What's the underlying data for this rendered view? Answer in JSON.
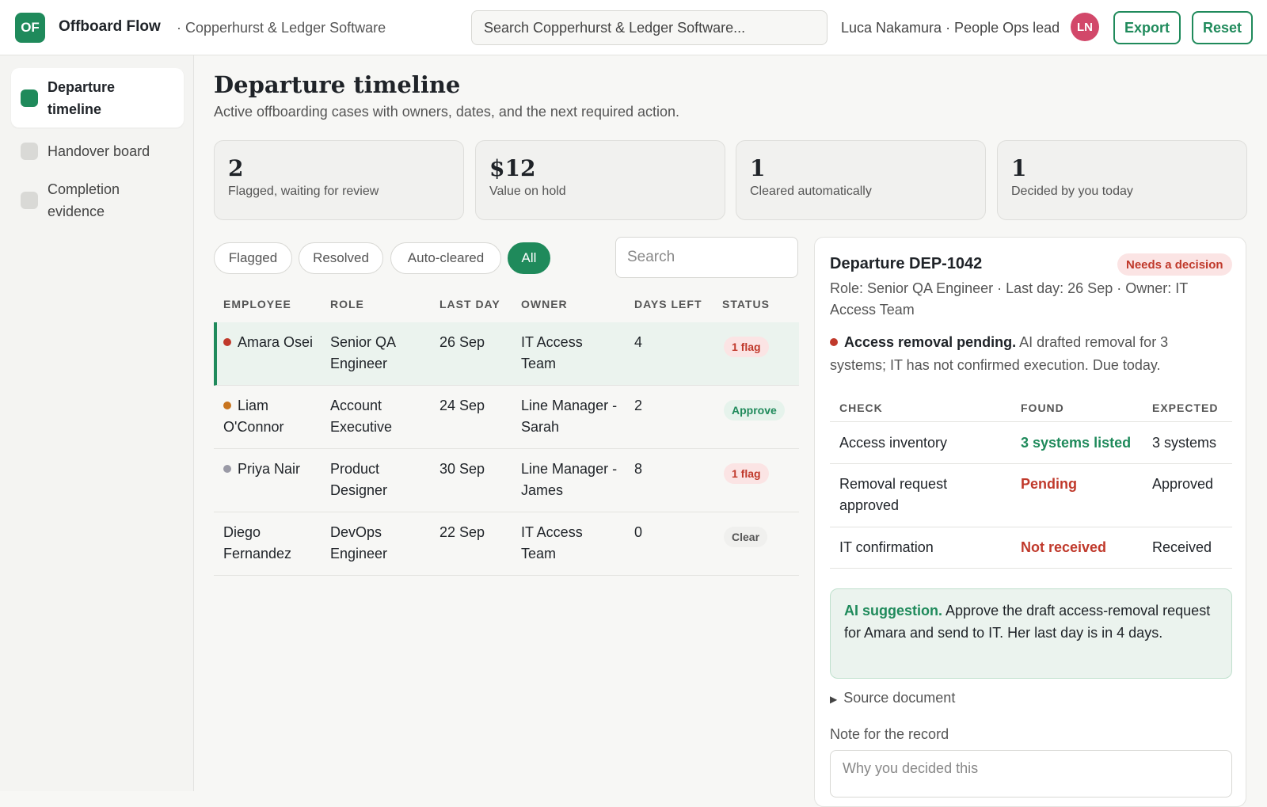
{
  "header": {
    "logo": "OF",
    "app_name": "Offboard Flow",
    "org": "· Copperhurst & Ledger Software",
    "search_placeholder": "Search Copperhurst & Ledger Software...",
    "user": "Luca Nakamura · People Ops lead",
    "avatar_initials": "LN",
    "export_label": "Export",
    "reset_label": "Reset"
  },
  "sidebar": {
    "items": [
      {
        "label": "Departure timeline",
        "active": true
      },
      {
        "label": "Handover board",
        "active": false
      },
      {
        "label": "Completion evidence",
        "active": false
      }
    ]
  },
  "main": {
    "title": "Departure timeline",
    "subtitle": "Active offboarding cases with owners, dates, and the next required action.",
    "stats": [
      {
        "value": "2",
        "label": "Flagged, waiting for review"
      },
      {
        "value": "$12",
        "label": "Value on hold"
      },
      {
        "value": "1",
        "label": "Cleared automatically"
      },
      {
        "value": "1",
        "label": "Decided by you today"
      }
    ],
    "filters": [
      {
        "label": "Flagged",
        "active": false
      },
      {
        "label": "Resolved",
        "active": false
      },
      {
        "label": "Auto-cleared",
        "active": false
      },
      {
        "label": "All",
        "active": true
      }
    ],
    "search_placeholder": "Search",
    "table": {
      "headers": [
        "EMPLOYEE",
        "ROLE",
        "LAST DAY",
        "OWNER",
        "DAYS LEFT",
        "STATUS"
      ],
      "rows": [
        {
          "employee": "Amara Osei",
          "dot_color": "#c0392b",
          "role": "Senior QA Engineer",
          "last_day": "26 Sep",
          "owner": "IT Access Team",
          "days_left": "4",
          "status": "1 flag",
          "status_type": "flag",
          "selected": true
        },
        {
          "employee": "Liam O'Connor",
          "dot_color": "#c8741e",
          "role": "Account Executive",
          "last_day": "24 Sep",
          "owner": "Line Manager - Sarah",
          "days_left": "2",
          "status": "Approve",
          "status_type": "approve",
          "selected": false
        },
        {
          "employee": "Priya Nair",
          "dot_color": "#9a9aa6",
          "role": "Product Designer",
          "last_day": "30 Sep",
          "owner": "Line Manager - James",
          "days_left": "8",
          "status": "1 flag",
          "status_type": "flag",
          "selected": false
        },
        {
          "employee": "Diego Fernandez",
          "dot_color": "",
          "role": "DevOps Engineer",
          "last_day": "22 Sep",
          "owner": "IT Access Team",
          "days_left": "0",
          "status": "Clear",
          "status_type": "clear",
          "selected": false
        }
      ]
    }
  },
  "detail": {
    "title": "Departure DEP-1042",
    "badge": "Needs a decision",
    "meta": "Role: Senior QA Engineer · Last day: 26 Sep · Owner: IT Access Team",
    "alert_title": "Access removal pending.",
    "alert_text": "AI drafted removal for 3 systems; IT has not confirmed execution. Due today.",
    "check_headers": [
      "CHECK",
      "FOUND",
      "EXPECTED"
    ],
    "checks": [
      {
        "check": "Access inventory",
        "found": "3 systems listed",
        "found_color": "#1f8a5b",
        "expected": "3 systems"
      },
      {
        "check": "Removal request approved",
        "found": "Pending",
        "found_color": "#c0392b",
        "expected": "Approved"
      },
      {
        "check": "IT confirmation",
        "found": "Not received",
        "found_color": "#c0392b",
        "expected": "Received"
      }
    ],
    "ai_label": "AI suggestion.",
    "ai_text": "Approve the draft access-removal request for Amara and send to IT. Her last day is in 4 days.",
    "source_doc": "Source document",
    "note_label": "Note for the record",
    "note_placeholder": "Why you decided this"
  },
  "colors": {
    "accent": "#1f8a5b",
    "danger": "#c0392b",
    "warning": "#c8741e"
  }
}
